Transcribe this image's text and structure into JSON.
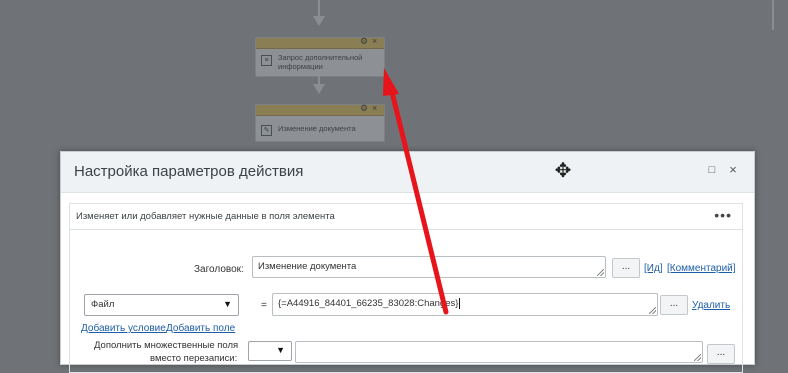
{
  "workflow": {
    "block1": {
      "label": "Запрос дополнительной информации",
      "icon": "form-icon"
    },
    "block2": {
      "label": "Изменение документа",
      "icon": "edit-document-icon"
    }
  },
  "dialog": {
    "title": "Настройка параметров действия",
    "move_glyph": "✥",
    "max_glyph": "□",
    "close_glyph": "×",
    "description": "Изменяет или добавляет нужные данные в поля элемента",
    "more_glyph": "•••",
    "title_field": {
      "label": "Заголовок:",
      "value": "Изменение документа",
      "dots": "...",
      "id_link": "[Ид]",
      "comment_link": "[Комментарий]"
    },
    "field_row": {
      "select_value": "Файл",
      "equals": "=",
      "value": "{=A44916_84401_66235_83028:Changes}",
      "dots": "...",
      "delete_link": "Удалить"
    },
    "add_condition": "Добавить условие",
    "add_field": "Добавить поле",
    "multi_fields": {
      "label_line1": "Дополнить множественные поля",
      "label_line2": "вместо перезаписи:",
      "dots": "..."
    }
  },
  "annotation": {
    "color": "#e8141c"
  }
}
